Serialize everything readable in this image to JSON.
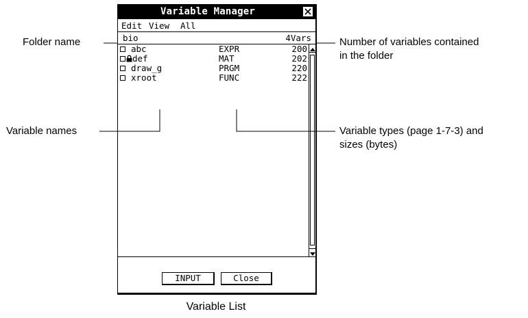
{
  "window": {
    "title": "Variable Manager",
    "close_icon": "close-x-icon"
  },
  "menu": {
    "items": [
      "Edit",
      "View",
      "All"
    ]
  },
  "folder": {
    "name": "bio",
    "count": "4Vars"
  },
  "variables": [
    {
      "checked": false,
      "locked": false,
      "name": "abc",
      "type": "EXPR",
      "size": "200"
    },
    {
      "checked": false,
      "locked": true,
      "name": "def",
      "type": "MAT",
      "size": "202"
    },
    {
      "checked": false,
      "locked": false,
      "name": "draw_g",
      "type": "PRGM",
      "size": "220"
    },
    {
      "checked": false,
      "locked": false,
      "name": "xroot",
      "type": "FUNC",
      "size": "222"
    }
  ],
  "buttons": {
    "input": "INPUT",
    "close": "Close"
  },
  "callouts": {
    "folder_name": "Folder name",
    "var_count": "Number of variables contained\nin the folder",
    "var_names": "Variable names",
    "var_types": "Variable types (page 1-7-3) and\nsizes (bytes)"
  },
  "caption": "Variable List"
}
